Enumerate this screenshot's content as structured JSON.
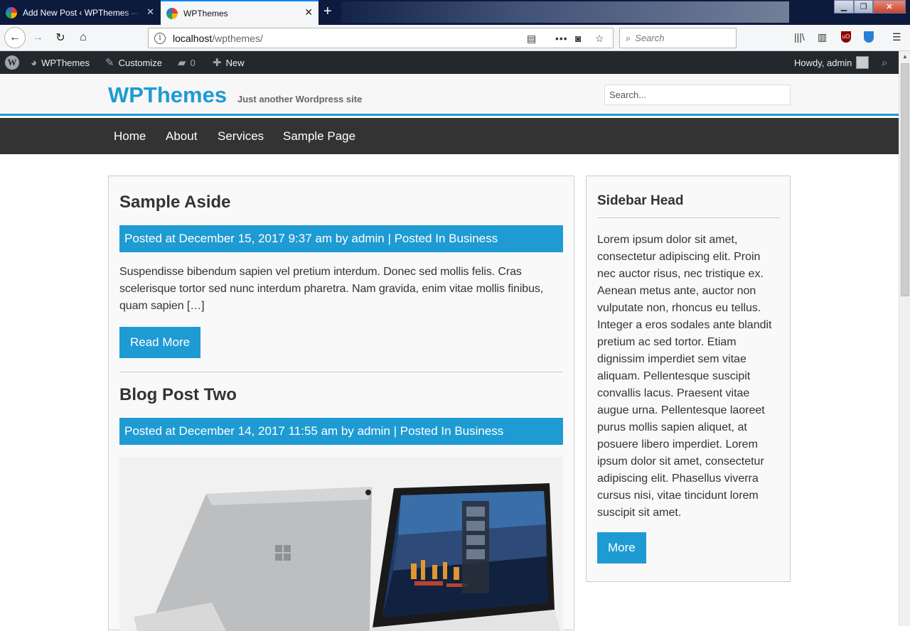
{
  "browser": {
    "tabs": [
      {
        "title": "Add New Post ‹ WPThemes — WordPress",
        "active": false
      },
      {
        "title": "WPThemes",
        "active": true
      }
    ],
    "url_host": "localhost",
    "url_path": "/wpthemes/",
    "search_placeholder": "Search"
  },
  "admin_bar": {
    "site_name": "WPThemes",
    "customize": "Customize",
    "comments_count": "0",
    "new_label": "New",
    "howdy": "Howdy, admin"
  },
  "site": {
    "title": "WPThemes",
    "tagline": "Just another Wordpress site",
    "search_placeholder": "Search..."
  },
  "nav": [
    "Home",
    "About",
    "Services",
    "Sample Page"
  ],
  "posts": [
    {
      "title": "Sample Aside",
      "meta": "Posted at December 15, 2017 9:37 am by admin | Posted In Business",
      "excerpt": "Suspendisse bibendum sapien vel pretium interdum. Donec sed mollis felis. Cras scelerisque tortor sed nunc interdum pharetra. Nam gravida, enim vitae mollis finibus, quam sapien […]",
      "read_more": "Read More"
    },
    {
      "title": "Blog Post Two",
      "meta": "Posted at December 14, 2017 11:55 am by admin | Posted In Business"
    }
  ],
  "sidebar": {
    "head": "Sidebar Head",
    "text": "Lorem ipsum dolor sit amet, consectetur adipiscing elit. Proin nec auctor risus, nec tristique ex. Aenean metus ante, auctor non vulputate non, rhoncus eu tellus. Integer a eros sodales ante blandit pretium ac sed tortor. Etiam dignissim imperdiet sem vitae aliquam. Pellentesque suscipit convallis lacus. Praesent vitae augue urna. Pellentesque laoreet purus mollis sapien aliquet, at posuere libero imperdiet. Lorem ipsum dolor sit amet, consectetur adipiscing elit. Phasellus viverra cursus nisi, vitae tincidunt lorem suscipit sit amet.",
    "more": "More"
  },
  "colors": {
    "accent": "#1e9bd3",
    "nav_bg": "#333333",
    "admin_bar_bg": "#23282d"
  }
}
